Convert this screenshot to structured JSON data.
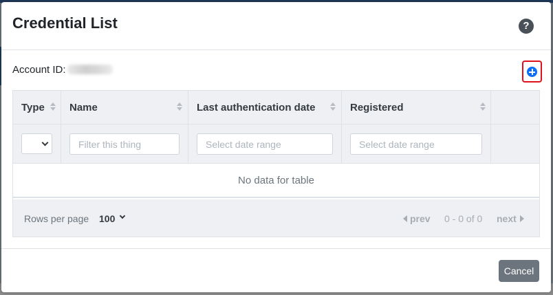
{
  "modal": {
    "title": "Credential List",
    "help_icon": "question-circle-icon",
    "account_label": "Account ID:",
    "add_icon": "plus-circle-icon",
    "accent_color": "#0d6efd",
    "highlight_color": "#e0101a"
  },
  "table": {
    "columns": [
      {
        "label": "Type"
      },
      {
        "label": "Name"
      },
      {
        "label": "Last authentication date"
      },
      {
        "label": "Registered"
      }
    ],
    "filters": {
      "type_select_value": "",
      "name_placeholder": "Filter this thing",
      "last_auth_placeholder": "Select date range",
      "registered_placeholder": "Select date range"
    },
    "empty_message": "No data for table"
  },
  "pager": {
    "rows_label": "Rows per page",
    "rows_value": "100",
    "prev_label": "prev",
    "range_text": "0 - 0 of 0",
    "next_label": "next"
  },
  "footer": {
    "cancel_label": "Cancel"
  }
}
